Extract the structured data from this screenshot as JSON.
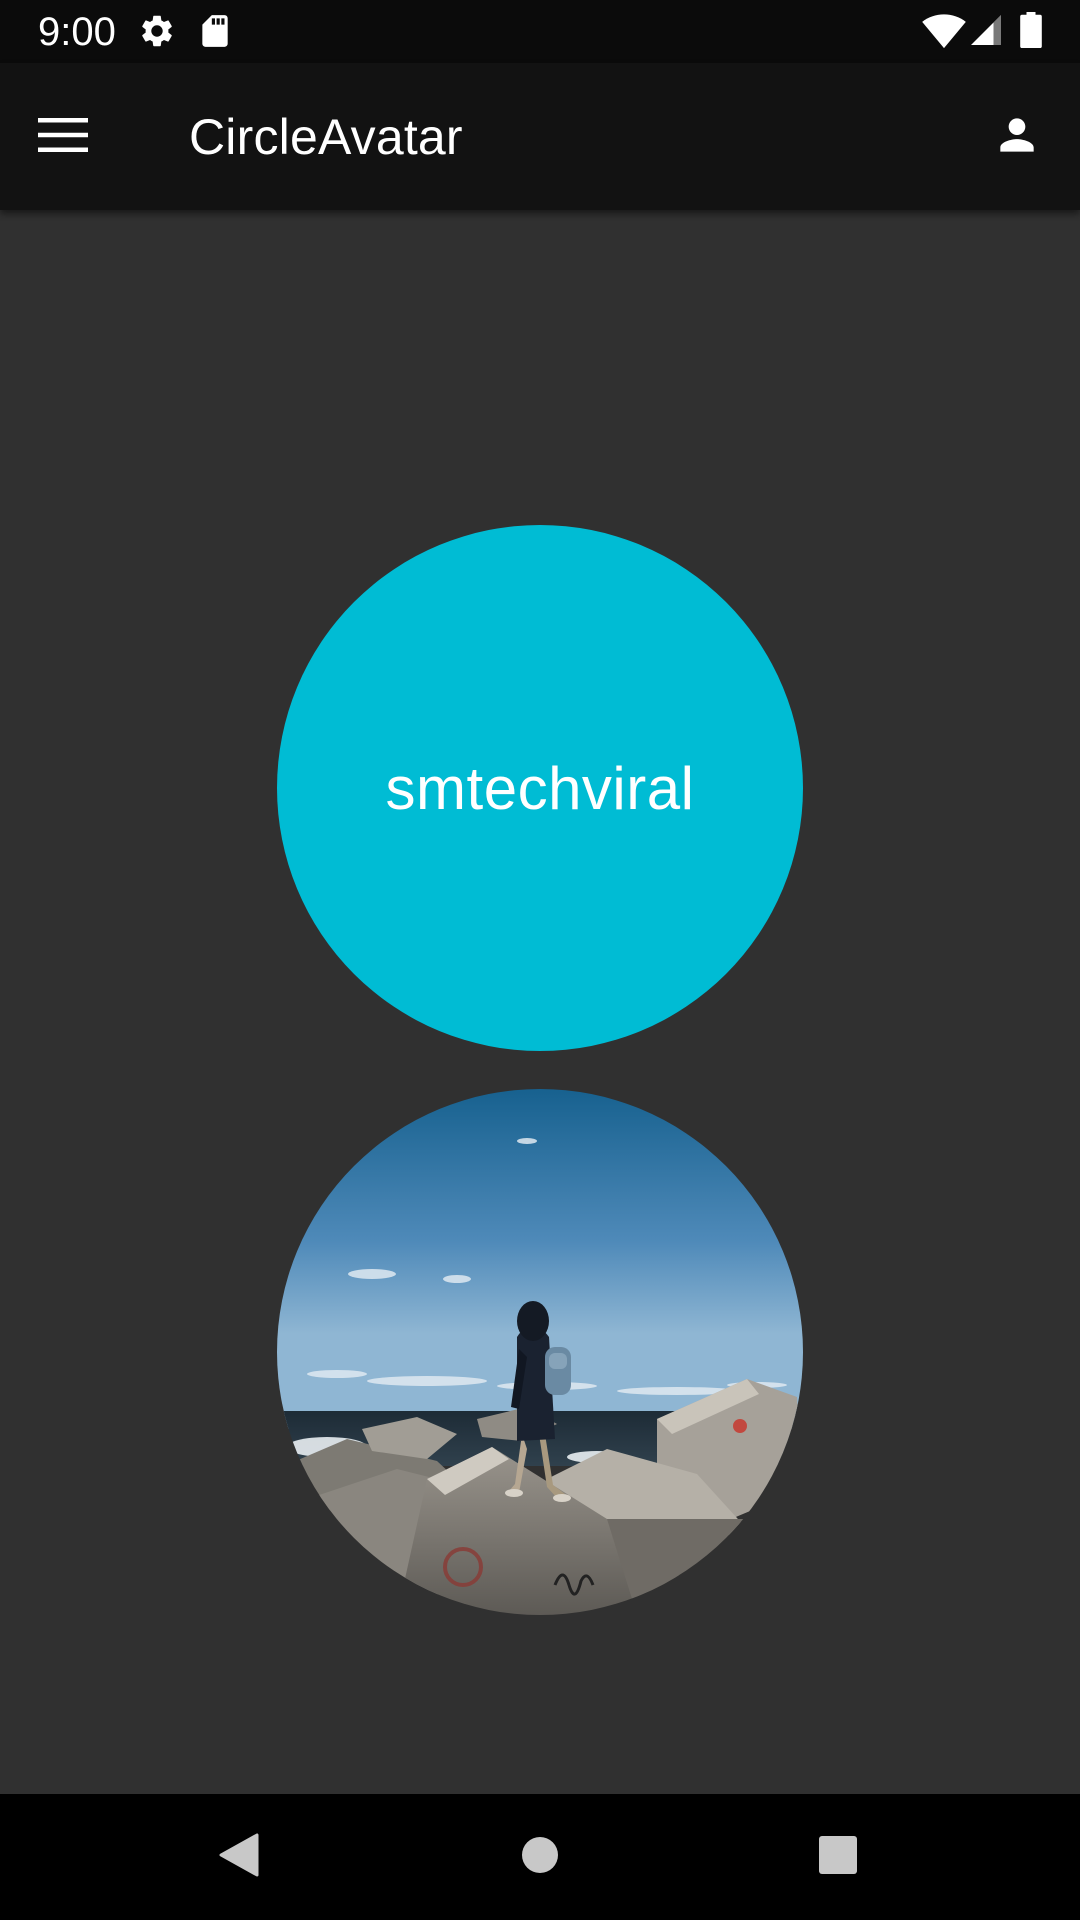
{
  "status_bar": {
    "time": "9:00",
    "left_icons": [
      "settings-icon",
      "sd-card-icon"
    ],
    "right_icons": [
      "wifi-icon",
      "cell-signal-icon",
      "battery-icon"
    ]
  },
  "app_bar": {
    "title": "CircleAvatar",
    "menu_icon": "menu-icon",
    "action_icon": "person-icon"
  },
  "avatars": {
    "text_avatar": {
      "label": "smtechviral",
      "background_color": "#00bcd4",
      "text_color": "#ffffff"
    },
    "image_avatar": {
      "image": "photo of hooded hiker with backpack on concrete breakwater blocks by the sea"
    }
  },
  "nav_bar": {
    "buttons": [
      "back-icon",
      "home-icon",
      "recents-icon"
    ]
  },
  "colors": {
    "background": "#303030",
    "app_bar": "#121212",
    "status_bar": "#0b0b0b",
    "nav_bar": "#000000",
    "accent": "#00bcd4"
  }
}
